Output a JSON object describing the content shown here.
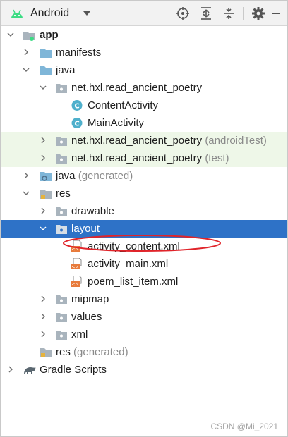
{
  "toolbar": {
    "title": "Android",
    "icons": [
      "android-icon",
      "chevron-down-icon",
      "locate-icon",
      "expand-all-icon",
      "collapse-all-icon",
      "gear-icon",
      "hide-icon"
    ]
  },
  "tree": {
    "app": "app",
    "manifests": "manifests",
    "java": "java",
    "package_main": "net.hxl.read_ancient_poetry",
    "content_activity": "ContentActivity",
    "main_activity": "MainActivity",
    "package_android_test": "net.hxl.read_ancient_poetry",
    "android_test_suffix": "(androidTest)",
    "package_test": "net.hxl.read_ancient_poetry",
    "test_suffix": "(test)",
    "java_generated": "java",
    "generated_suffix": "(generated)",
    "res": "res",
    "drawable": "drawable",
    "layout": "layout",
    "activity_content": "activity_content.xml",
    "activity_main": "activity_main.xml",
    "poem_list_item": "poem_list_item.xml",
    "mipmap": "mipmap",
    "values": "values",
    "xml": "xml",
    "res_generated": "res",
    "res_generated_suffix": "(generated)",
    "gradle_scripts": "Gradle Scripts"
  },
  "colors": {
    "selection": "#2e72c7",
    "test_highlight": "#eef7e8",
    "folder": "#7fb6d8",
    "class_icon": "#4fb0cc",
    "xml_icon": "#e87b3c",
    "annotation": "#e0242a"
  },
  "watermark": "CSDN @Mi_2021"
}
